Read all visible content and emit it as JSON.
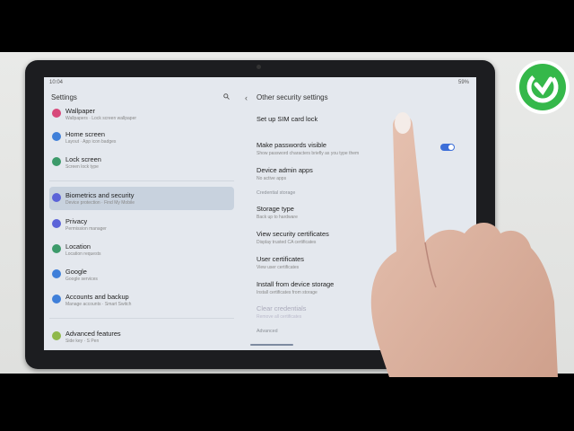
{
  "status": {
    "time": "10:04",
    "battery": "59%"
  },
  "left": {
    "title": "Settings",
    "items": [
      {
        "label": "Wallpaper",
        "sub": "Wallpapers  ·  Lock screen wallpaper",
        "color": "#d7487a"
      },
      {
        "label": "Home screen",
        "sub": "Layout  ·  App icon badges",
        "color": "#3f7fd9"
      },
      {
        "label": "Lock screen",
        "sub": "Screen lock type",
        "color": "#3c9a6a"
      },
      {
        "label": "Biometrics and security",
        "sub": "Device protection  ·  Find My Mobile",
        "color": "#5b63d8"
      },
      {
        "label": "Privacy",
        "sub": "Permission manager",
        "color": "#5b63d8"
      },
      {
        "label": "Location",
        "sub": "Location requests",
        "color": "#3c9a6a"
      },
      {
        "label": "Google",
        "sub": "Google services",
        "color": "#3f7fd9"
      },
      {
        "label": "Accounts and backup",
        "sub": "Manage accounts  ·  Smart Switch",
        "color": "#3f7fd9"
      },
      {
        "label": "Advanced features",
        "sub": "Side key  ·  S Pen",
        "color": "#8fb84a"
      }
    ]
  },
  "right": {
    "back": "‹",
    "title": "Other security settings",
    "sim_lock": {
      "label": "Set up SIM card lock"
    },
    "passwords": {
      "label": "Make passwords visible",
      "sub": "Show password characters briefly as you type them"
    },
    "device_admin": {
      "label": "Device admin apps",
      "sub": "No active apps"
    },
    "credential_storage_header": "Credential storage",
    "storage_type": {
      "label": "Storage type",
      "sub": "Back up to hardware"
    },
    "view_certs": {
      "label": "View security certificates",
      "sub": "Display trusted CA certificates"
    },
    "user_certs": {
      "label": "User certificates",
      "sub": "View user certificates"
    },
    "install_storage": {
      "label": "Install from device storage",
      "sub": "Install certificates from storage"
    },
    "clear_credentials": {
      "label": "Clear credentials",
      "sub": "Remove all certificates"
    },
    "advanced_header": "Advanced"
  },
  "toggle_on": true
}
